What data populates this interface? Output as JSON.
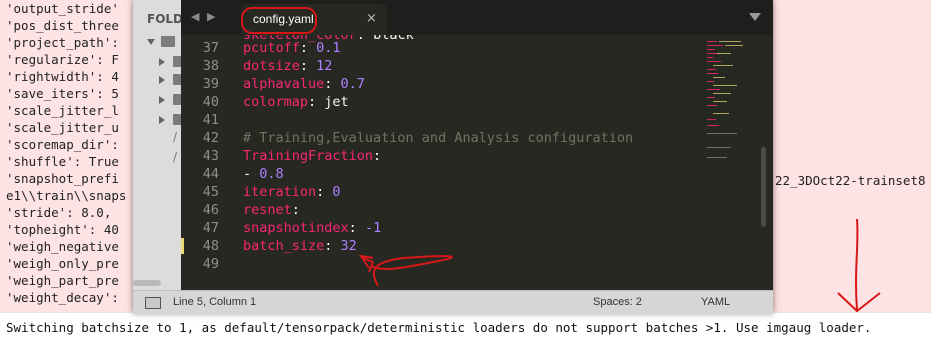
{
  "background_output": {
    "lines": [
      "'output_stride'",
      "'pos_dist_three",
      "'project_path':",
      "'regularize': F",
      "'rightwidth': 4",
      "'save_iters': 5",
      "'scale_jitter_l",
      "'scale_jitter_u",
      "'scoremap_dir':",
      "'shuffle': True",
      "'snapshot_prefi",
      "e1\\\\train\\\\snaps",
      "'stride': 8.0,",
      "'topheight': 40",
      "'weigh_negative",
      "'weigh_only_pre",
      "'weigh_part_pre",
      "'weight_decay':"
    ],
    "right_fragment": "22_3DOct22-trainset8",
    "bottom_message": "Switching batchsize to 1, as default/tensorpack/deterministic loaders do not support batches >1. Use imgaug loader."
  },
  "editor": {
    "sidebar_title": "FOLD",
    "nav_arrows": "◀ ▶",
    "tab_label": "config.yaml",
    "tab_close": "×",
    "code_lines": [
      {
        "n": "37",
        "key": "pcutoff",
        "val": "0.1",
        "val_type": "num"
      },
      {
        "n": "38",
        "key": "dotsize",
        "val": "12",
        "val_type": "num"
      },
      {
        "n": "39",
        "key": "alphavalue",
        "val": "0.7",
        "val_type": "num"
      },
      {
        "n": "40",
        "key": "colormap",
        "val": "jet",
        "val_type": "str"
      },
      {
        "n": "41",
        "key": "",
        "val": "",
        "val_type": "none"
      },
      {
        "n": "42",
        "comment": "# Training,Evaluation and Analysis configuration"
      },
      {
        "n": "43",
        "key": "TrainingFraction",
        "val": "",
        "val_type": "none"
      },
      {
        "n": "44",
        "list_item": "0.8"
      },
      {
        "n": "45",
        "key": "iteration",
        "val": "0",
        "val_type": "num"
      },
      {
        "n": "46",
        "key": "resnet",
        "val": "",
        "val_type": "none"
      },
      {
        "n": "47",
        "key": "snapshotindex",
        "val": "-1",
        "val_type": "num"
      },
      {
        "n": "48",
        "key": "batch_size",
        "val": "32",
        "val_type": "num"
      },
      {
        "n": "49",
        "key": "",
        "val": "",
        "val_type": "none"
      }
    ],
    "top_partial_line": {
      "key": "skeleton_color",
      "val": "black"
    },
    "status": {
      "position": "Line 5, Column 1",
      "spaces": "Spaces: 2",
      "syntax": "YAML"
    }
  },
  "colors": {
    "annotation_red": "#d81818",
    "key_pink": "#f92672",
    "number_purple": "#ae81ff",
    "comment_gray": "#75715e"
  }
}
